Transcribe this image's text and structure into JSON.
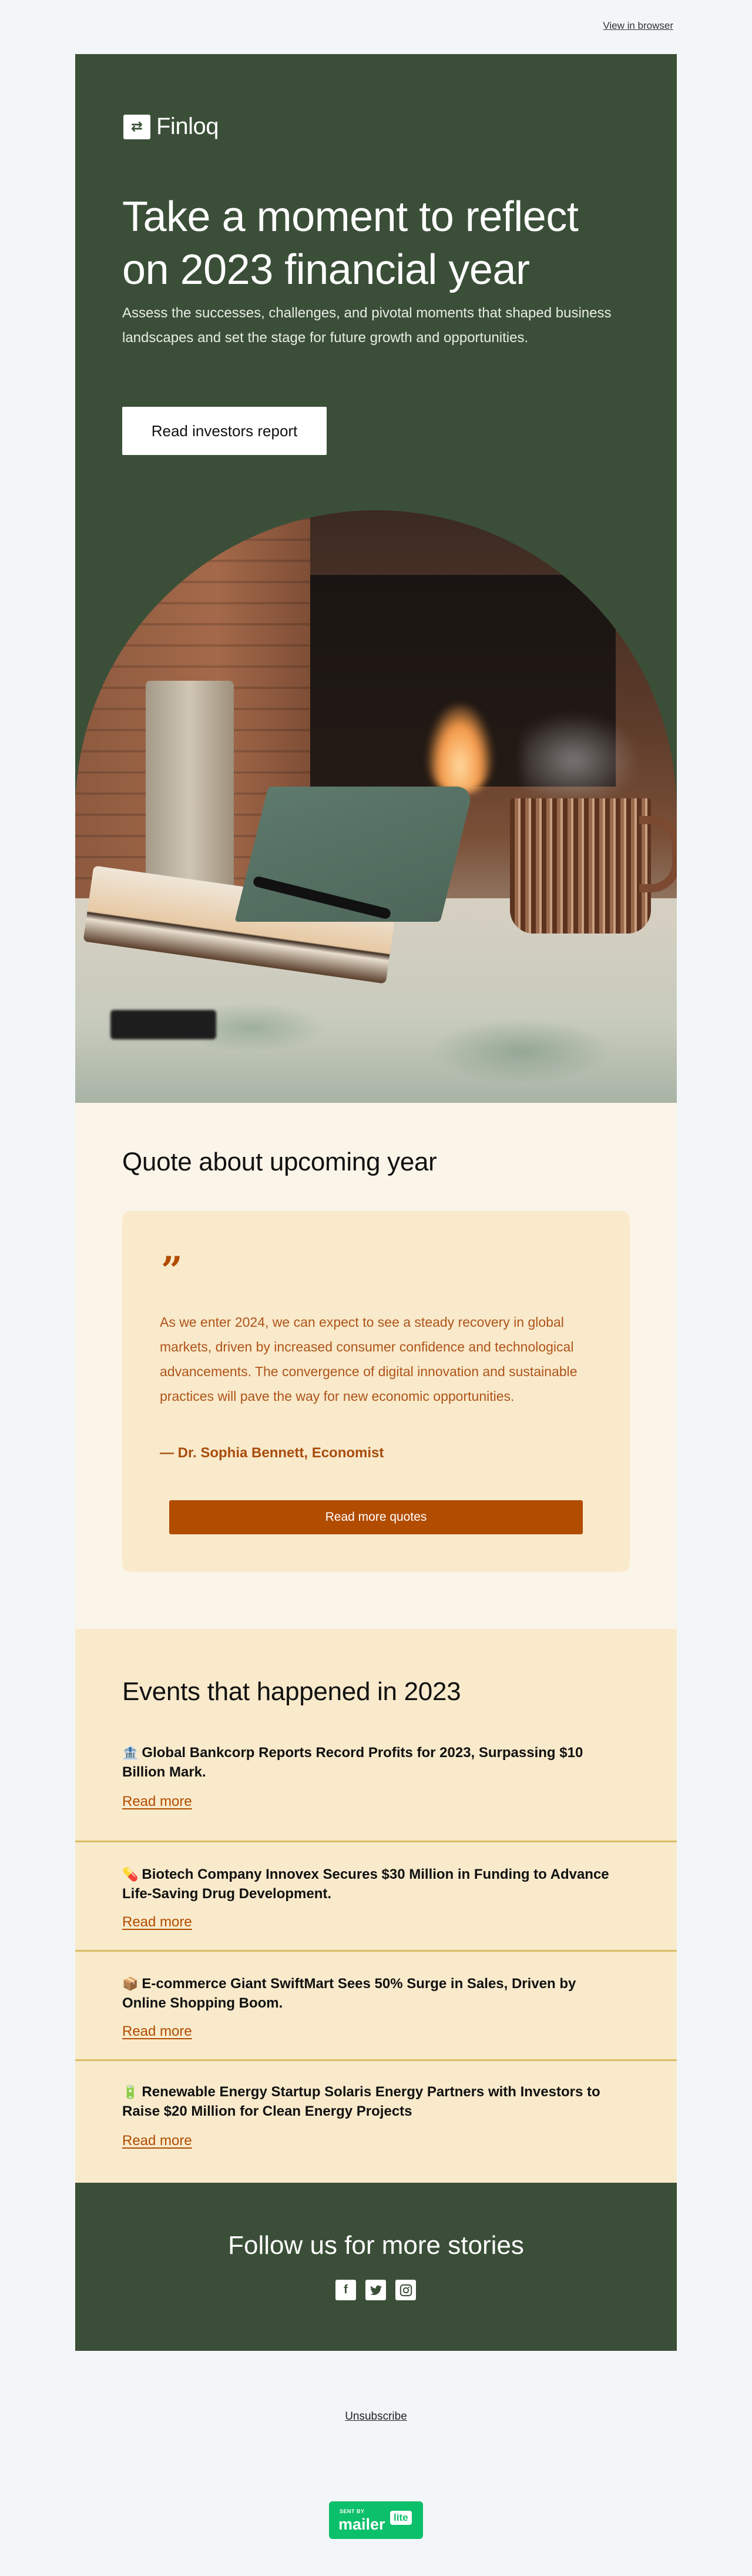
{
  "top_bar": {
    "view_in_browser": "View in browser"
  },
  "hero": {
    "logo_icon": "swap-arrows-icon",
    "logo_glyph": "⇄",
    "brand_name": "Finloq",
    "title": "Take a moment to reflect on 2023 financial year",
    "text": "Assess the successes, challenges, and pivotal moments that shaped business landscapes and set the stage for future growth and opportunities.",
    "button_label": "Read investors report",
    "image_alt": "Notebook, pen and steaming mug in front of a fireplace"
  },
  "quote_section": {
    "title": "Quote about upcoming year",
    "quote_mark": "”",
    "quote": "As we enter 2024, we can expect to see a steady recovery in global markets, driven by increased consumer confidence and technological advancements. The convergence of digital innovation and sustainable practices will pave the way for new economic opportunities.",
    "author": "— Dr. Sophia Bennett, Economist",
    "button_label": "Read more quotes"
  },
  "events_section": {
    "title": "Events that happened in 2023",
    "items": [
      {
        "emoji": "🏦",
        "icon": "bank-icon",
        "title": "Global Bankcorp Reports Record Profits for 2023, Surpassing $10 Billion Mark.",
        "link": "Read more"
      },
      {
        "emoji": "💊",
        "icon": "pill-icon",
        "title": "Biotech Company Innovex Secures $30 Million in Funding to Advance Life-Saving Drug Development.",
        "link": "Read more"
      },
      {
        "emoji": "📦",
        "icon": "package-icon",
        "title": "E-commerce Giant SwiftMart Sees 50% Surge in Sales, Driven by Online Shopping Boom.",
        "link": "Read more"
      },
      {
        "emoji": "🔋",
        "icon": "battery-icon",
        "title": "Renewable Energy Startup Solaris Energy Partners with Investors to Raise $20 Million for Clean Energy Projects",
        "link": "Read more"
      }
    ]
  },
  "follow_section": {
    "title": "Follow us for more stories",
    "socials": [
      {
        "name": "facebook-icon",
        "glyph": "f"
      },
      {
        "name": "twitter-icon",
        "glyph": "🐦"
      },
      {
        "name": "instagram-icon",
        "glyph": "◎"
      }
    ]
  },
  "footer": {
    "unsubscribe": "Unsubscribe",
    "badge_sent_by": "SENT BY",
    "badge_mailer": "mailer",
    "badge_lite": "lite"
  },
  "colors": {
    "page_bg": "#f3f6f9",
    "brand_green": "#3b4f38",
    "quote_bg": "#fbf4e8",
    "card_bg": "#f8eacb",
    "accent_orange": "#b24c00",
    "divider_gold": "#d9bc64",
    "mailerlite_green": "#0cbf6a"
  }
}
